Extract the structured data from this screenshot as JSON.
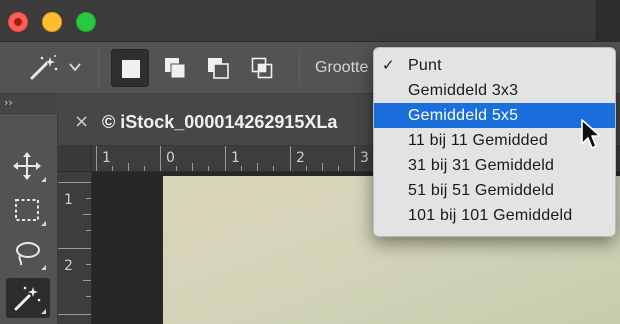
{
  "window": {
    "traffic_lights": [
      "close",
      "minimize",
      "zoom"
    ],
    "colors": {
      "close": "#ff5f57",
      "minimize": "#febc2e",
      "zoom": "#28c840"
    }
  },
  "options_bar": {
    "tool_preset_icon": "magic-wand-icon",
    "selection_modes": [
      {
        "name": "new-selection",
        "active": true
      },
      {
        "name": "add-to-selection",
        "active": false
      },
      {
        "name": "subtract-from-selection",
        "active": false
      },
      {
        "name": "intersect-selection",
        "active": false
      }
    ],
    "sample_size_label": "Grootte"
  },
  "toolbar": {
    "collapse_glyph": "››",
    "tools": [
      {
        "name": "move-tool",
        "icon": "move-icon",
        "active": false
      },
      {
        "name": "marquee-tool",
        "icon": "rectangular-marquee-icon",
        "active": false
      },
      {
        "name": "lasso-tool",
        "icon": "lasso-icon",
        "active": false
      },
      {
        "name": "magic-wand-tool",
        "icon": "magic-wand-icon",
        "active": true
      }
    ]
  },
  "document": {
    "tab_close_glyph": "×",
    "tab_title": "© iStock_000014262915XLa",
    "ruler_h_labels": [
      "1",
      "0",
      "1",
      "2",
      "3"
    ],
    "ruler_v_labels": [
      "1",
      "2"
    ]
  },
  "sample_size_menu": {
    "selected": "Punt",
    "highlighted": "Gemiddeld 5x5",
    "check_glyph": "✓",
    "items": [
      {
        "label": "Punt",
        "checked": true,
        "highlighted": false
      },
      {
        "label": "Gemiddeld 3x3",
        "checked": false,
        "highlighted": false
      },
      {
        "label": "Gemiddeld 5x5",
        "checked": false,
        "highlighted": true
      },
      {
        "label": "11 bij 11 Gemidded",
        "checked": false,
        "highlighted": false
      },
      {
        "label": "31 bij 31 Gemiddeld",
        "checked": false,
        "highlighted": false
      },
      {
        "label": "51 bij 51 Gemiddeld",
        "checked": false,
        "highlighted": false
      },
      {
        "label": "101 bij 101 Gemiddeld",
        "checked": false,
        "highlighted": false
      }
    ],
    "highlight_color": "#1a6fdc"
  }
}
